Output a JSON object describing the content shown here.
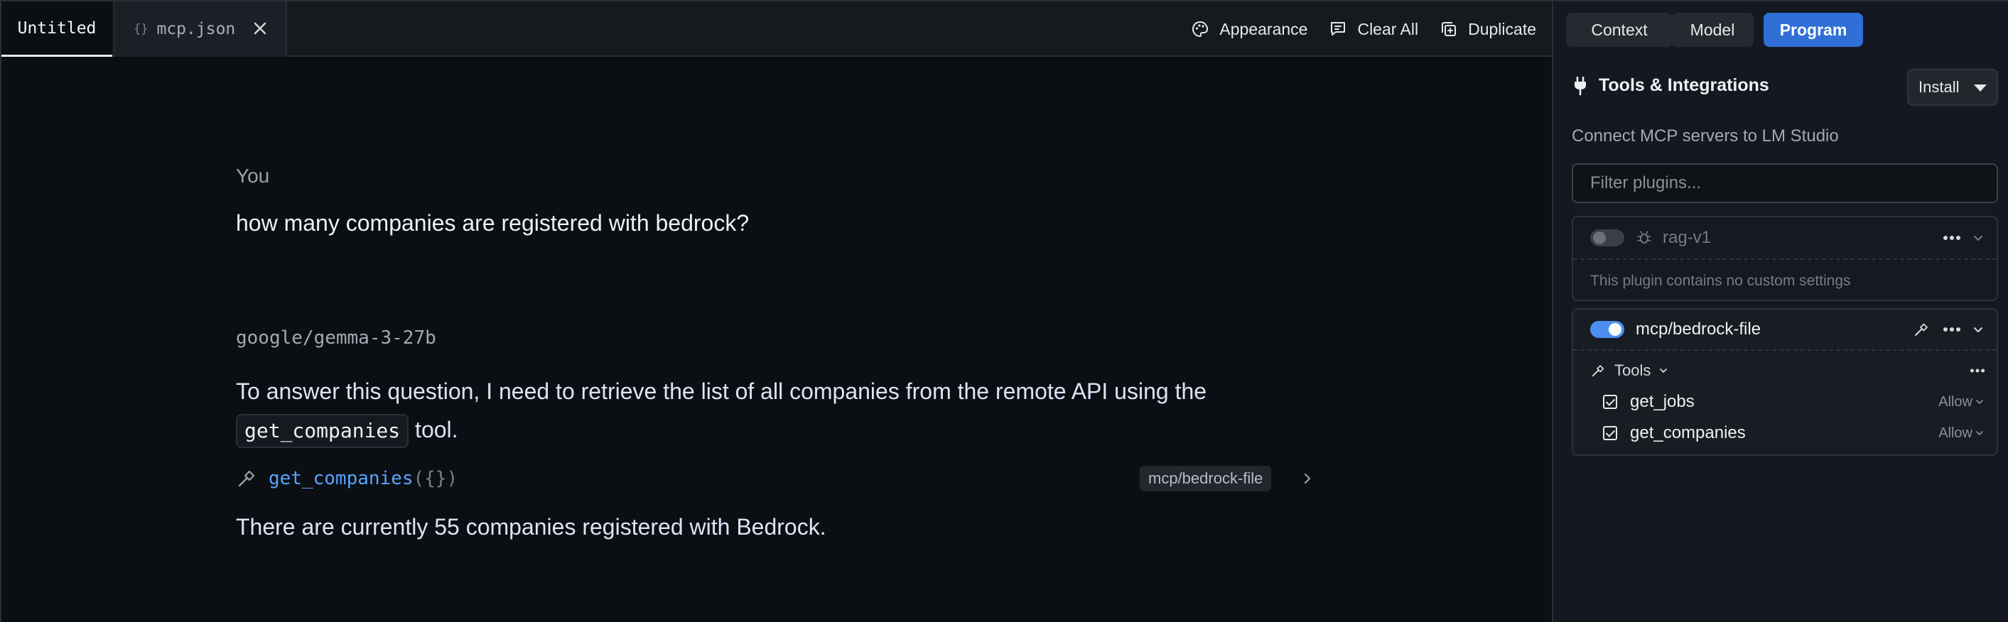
{
  "tabs": [
    {
      "label": "Untitled"
    },
    {
      "label": "mcp.json"
    }
  ],
  "toolbar": {
    "appearance": "Appearance",
    "clear_all": "Clear All",
    "duplicate": "Duplicate"
  },
  "conversation": {
    "user_role": "You",
    "user_message": "how many companies are registered with bedrock?",
    "model_name": "google/gemma-3-27b",
    "answer_prefix": "To answer this question, I need to retrieve the list of all companies from the remote API using the",
    "answer_code": "get_companies",
    "answer_suffix": " tool.",
    "tool_call": {
      "function": "get_companies",
      "args": "({})",
      "source": "mcp/bedrock-file"
    },
    "final_answer": "There are currently 55 companies registered with Bedrock."
  },
  "sidebar": {
    "segments": {
      "context": "Context",
      "model": "Model",
      "program": "Program"
    },
    "selected_segment": "Program",
    "section_title": "Tools & Integrations",
    "install_label": "Install",
    "subtitle": "Connect MCP servers to LM Studio",
    "filter_placeholder": "Filter plugins...",
    "plugins": [
      {
        "name": "rag-v1",
        "enabled": false,
        "note": "This plugin contains no custom settings"
      },
      {
        "name": "mcp/bedrock-file",
        "enabled": true,
        "tools_label": "Tools",
        "tools": [
          {
            "name": "get_jobs",
            "checked": true,
            "permission": "Allow"
          },
          {
            "name": "get_companies",
            "checked": true,
            "permission": "Allow"
          }
        ]
      }
    ]
  },
  "colors": {
    "background": "#0b0f14",
    "sidebar": "#141820",
    "accent": "#2f6fd6",
    "link": "#5aa3ff",
    "assistant_text": "#e3e0f5"
  }
}
